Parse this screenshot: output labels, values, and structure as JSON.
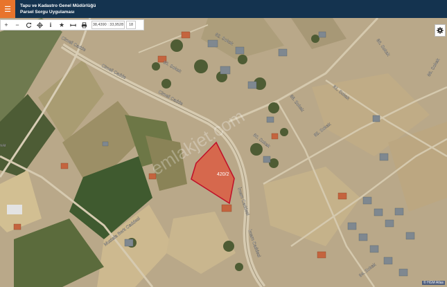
{
  "header": {
    "title": "Tapu ve Kadastro Genel Müdürlüğü",
    "subtitle": "Parsel Sorgu Uygulaması",
    "menu_icon": "hamburger-icon"
  },
  "toolbar": {
    "coordinates": "38,4390 : 33,9528",
    "zoom": "18"
  },
  "map": {
    "parcel_label": "420/2",
    "watermark": "emlakjet.com",
    "attribution": "© HGM Atlas",
    "streets": [
      "Cimeli Cadde",
      "Cimeli Cadde",
      "Cimeli Cadde",
      "İmam Caddesi",
      "İmam Caddesi",
      "Mustafa Berk Caddesi",
      "80. Sokak",
      "82. Sokak",
      "80. Sokak",
      "88. Sokak",
      "85. Sokak",
      "86. Sokak",
      "81. Sokak",
      "86. Sokak",
      "84. Sokak",
      "var"
    ]
  },
  "colors": {
    "header_bg": "#14334f",
    "menu_bg": "#e8742c",
    "parcel_fill": "#e0533a",
    "parcel_stroke": "#c0122a"
  }
}
